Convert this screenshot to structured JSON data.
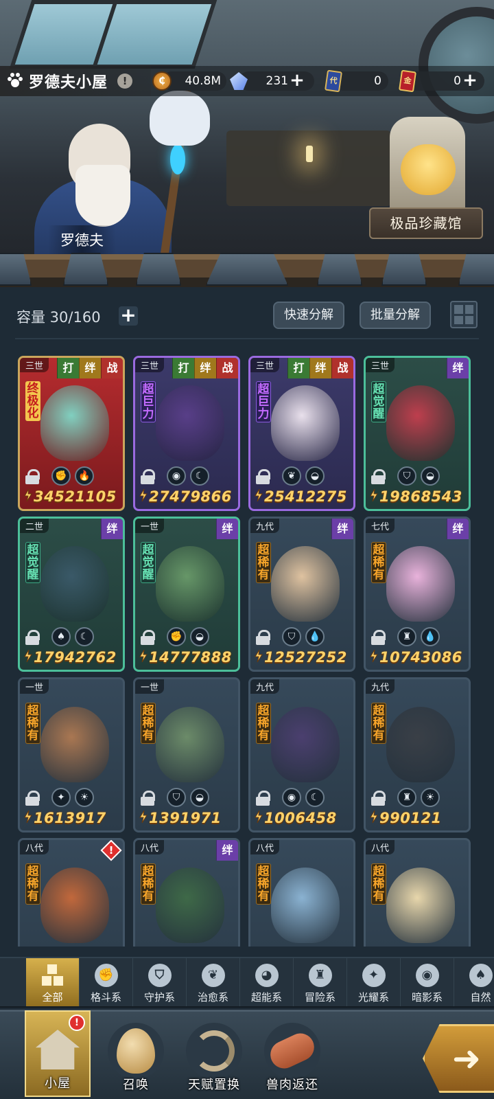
{
  "header": {
    "location_title": "罗德夫小屋",
    "info_icon": "info-icon",
    "npc_name": "罗德夫",
    "museum_label": "极品珍藏馆"
  },
  "resources": {
    "gold": {
      "icon": "gold-coin-icon",
      "value": "40.8M"
    },
    "crystal": {
      "icon": "crystal-icon",
      "value": "231"
    },
    "blue_ticket": {
      "icon": "blue-card-icon",
      "value": "0"
    },
    "red_ticket": {
      "icon": "red-card-icon",
      "value": "0"
    }
  },
  "toolbar": {
    "capacity_label": "容量 30/160",
    "quick_decompose": "快速分解",
    "batch_decompose": "批量分解"
  },
  "cards": [
    {
      "gen": "三世",
      "tags": [
        "打",
        "绊",
        "战"
      ],
      "rank": "终极化",
      "style": "red",
      "elements": [
        "fist",
        "fire"
      ],
      "power": "34521105",
      "color": "#7fd9c8"
    },
    {
      "gen": "三世",
      "tags": [
        "打",
        "绊",
        "战"
      ],
      "rank": "超巨力",
      "style": "purple",
      "elements": [
        "eye",
        "moon"
      ],
      "power": "27479866",
      "color": "#5a3f8a"
    },
    {
      "gen": "三世",
      "tags": [
        "打",
        "绊",
        "战"
      ],
      "rank": "超巨力",
      "style": "purple",
      "elements": [
        "sprout",
        "rock"
      ],
      "power": "25412275",
      "color": "#f2e9f3"
    },
    {
      "gen": "三世",
      "tags": [
        "绊"
      ],
      "rank": "超觉醒",
      "style": "green",
      "elements": [
        "shield",
        "rock"
      ],
      "power": "19868543",
      "color": "#c63e4e"
    },
    {
      "gen": "二世",
      "tags": [
        "绊"
      ],
      "rank": "超觉醒",
      "style": "green",
      "elements": [
        "leaf",
        "moon"
      ],
      "power": "17942762",
      "color": "#3b5a6a"
    },
    {
      "gen": "一世",
      "tags": [
        "绊"
      ],
      "rank": "超觉醒",
      "style": "green",
      "elements": [
        "fist",
        "rock"
      ],
      "power": "14777888",
      "color": "#6a9b6a"
    },
    {
      "gen": "九代",
      "tags": [
        "绊"
      ],
      "rank": "超稀有",
      "style": "plain",
      "elements": [
        "shield",
        "water"
      ],
      "power": "12527252",
      "color": "#e8c9a4"
    },
    {
      "gen": "七代",
      "tags": [
        "绊"
      ],
      "rank": "超稀有",
      "style": "plain",
      "elements": [
        "tower",
        "water"
      ],
      "power": "10743086",
      "color": "#f2b8e2"
    },
    {
      "gen": "一世",
      "tags": [],
      "rank": "超稀有",
      "style": "plain",
      "elements": [
        "star",
        "sun"
      ],
      "power": "1613917",
      "color": "#b07a52"
    },
    {
      "gen": "一世",
      "tags": [],
      "rank": "超稀有",
      "style": "plain",
      "elements": [
        "shield",
        "rock"
      ],
      "power": "1391971",
      "color": "#6f8f6a"
    },
    {
      "gen": "九代",
      "tags": [],
      "rank": "超稀有",
      "style": "plain",
      "elements": [
        "eye",
        "moon"
      ],
      "power": "1006458",
      "color": "#4c3f70"
    },
    {
      "gen": "九代",
      "tags": [],
      "rank": "超稀有",
      "style": "plain",
      "elements": [
        "tower",
        "sun"
      ],
      "power": "990121",
      "color": "#3a3f46"
    },
    {
      "gen": "八代",
      "tags": [],
      "alert": true,
      "rank": "超稀有",
      "style": "plain",
      "elements": [],
      "power": "",
      "color": "#c96a3a"
    },
    {
      "gen": "八代",
      "tags": [
        "绊"
      ],
      "rank": "超稀有",
      "style": "plain",
      "elements": [],
      "power": "",
      "color": "#3f6b47"
    },
    {
      "gen": "八代",
      "tags": [],
      "rank": "超稀有",
      "style": "plain",
      "elements": [],
      "power": "",
      "color": "#8fb8d8"
    },
    {
      "gen": "八代",
      "tags": [],
      "rank": "超稀有",
      "style": "plain",
      "elements": [],
      "power": "",
      "color": "#f1deb0"
    }
  ],
  "categories": [
    {
      "label": "全部",
      "icon": "all-grid-icon",
      "active": true
    },
    {
      "label": "格斗系",
      "icon": "fist-icon"
    },
    {
      "label": "守护系",
      "icon": "shield-icon"
    },
    {
      "label": "治愈系",
      "icon": "sprout-icon"
    },
    {
      "label": "超能系",
      "icon": "alien-icon"
    },
    {
      "label": "冒险系",
      "icon": "lantern-icon"
    },
    {
      "label": "光耀系",
      "icon": "star-icon"
    },
    {
      "label": "暗影系",
      "icon": "eye-icon"
    },
    {
      "label": "自然",
      "icon": "leaf-icon"
    }
  ],
  "nav": [
    {
      "label": "小屋",
      "icon": "house-icon",
      "active": true,
      "badge": "!"
    },
    {
      "label": "召唤",
      "icon": "egg-icon"
    },
    {
      "label": "天赋置换",
      "icon": "swap-icon"
    },
    {
      "label": "兽肉返还",
      "icon": "meat-icon"
    }
  ],
  "go_button": {
    "icon": "arrow-right-icon"
  }
}
